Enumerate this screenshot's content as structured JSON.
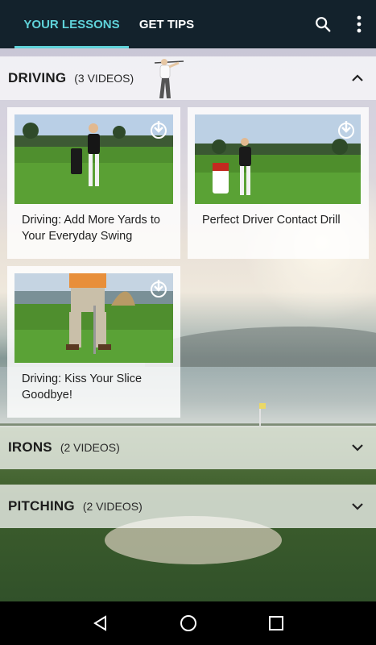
{
  "tabs": [
    {
      "label": "YOUR LESSONS",
      "active": true
    },
    {
      "label": "GET TIPS",
      "active": false
    }
  ],
  "toolbar": {
    "search_icon": "search-icon",
    "menu_icon": "more-vert-icon"
  },
  "sections": [
    {
      "title": "DRIVING",
      "count": "(3 VIDEOS)",
      "expanded": true
    },
    {
      "title": "IRONS",
      "count": "(2 VIDEOS)",
      "expanded": false
    },
    {
      "title": "PITCHING",
      "count": "(2 VIDEOS)",
      "expanded": false
    }
  ],
  "videos": [
    {
      "caption": "Driving: Add More Yards to Your Everyday Swing",
      "icon": "download-icon"
    },
    {
      "caption": "Perfect Driver Contact Drill",
      "icon": "download-icon"
    },
    {
      "caption": "Driving: Kiss Your Slice Goodbye!",
      "icon": "download-icon"
    }
  ],
  "colors": {
    "accent": "#5fd2d9",
    "appbar": "#13222c",
    "navbar": "#000000"
  },
  "navbar": {
    "back_icon": "back-triangle-icon",
    "home_icon": "home-circle-icon",
    "recents_icon": "recents-square-icon"
  }
}
